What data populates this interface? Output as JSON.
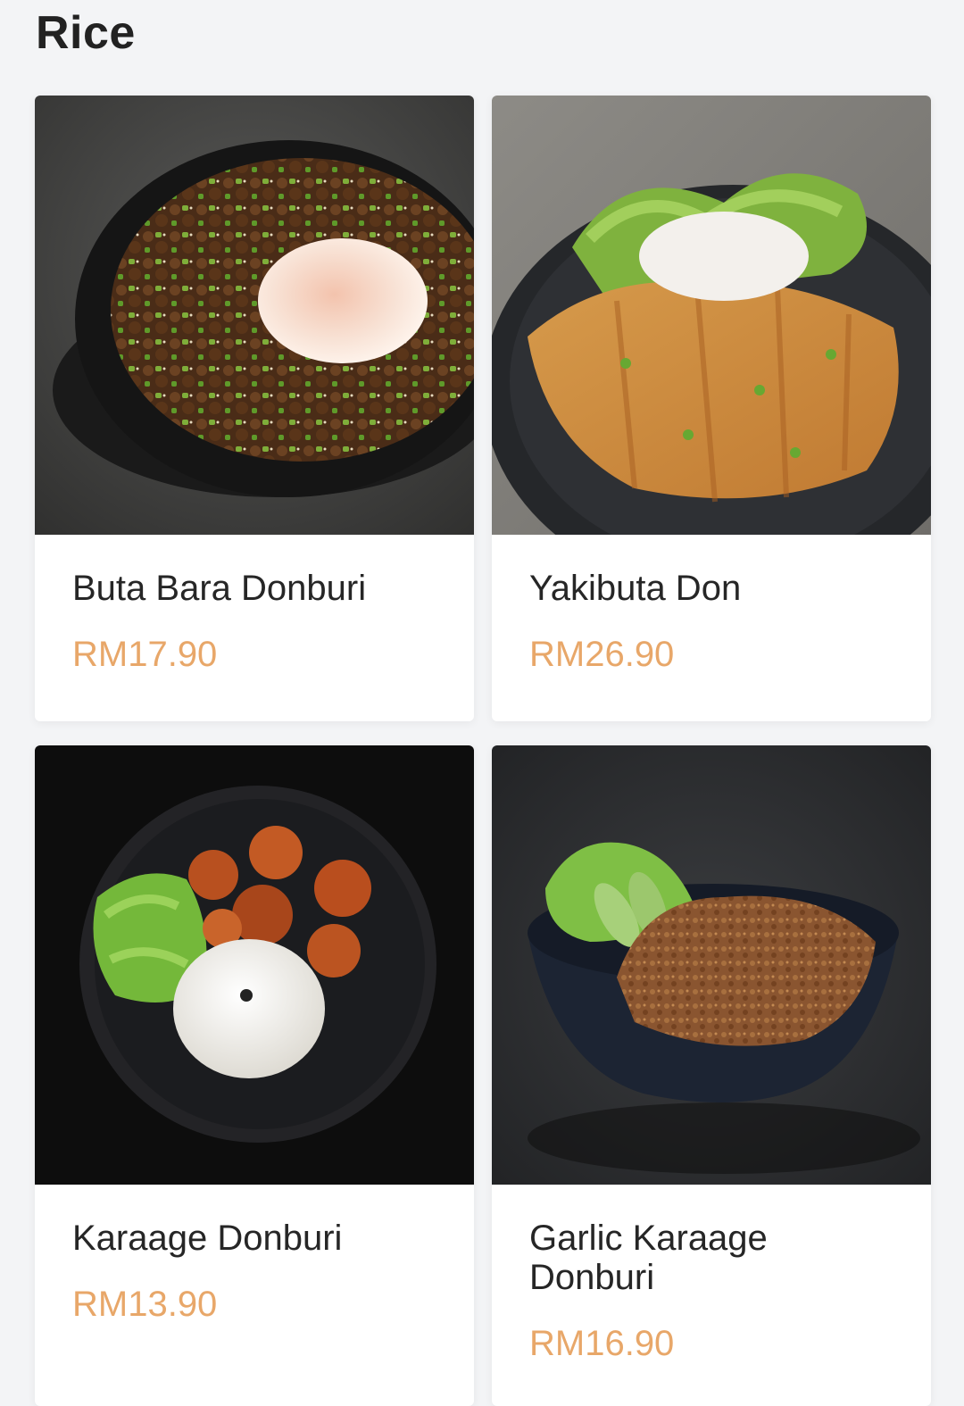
{
  "section": {
    "title": "Rice"
  },
  "colors": {
    "price": "#e8a769",
    "background": "#f3f4f6",
    "card": "#ffffff"
  },
  "items": [
    {
      "name": "Buta Bara Donburi",
      "price": "RM17.90",
      "image": "pork-donburi-egg-photo"
    },
    {
      "name": "Yakibuta Don",
      "price": "RM26.90",
      "image": "yakibuta-don-photo"
    },
    {
      "name": "Karaage Donburi",
      "price": "RM13.90",
      "image": "karaage-rice-photo"
    },
    {
      "name": "Garlic Karaage Donburi",
      "price": "RM16.90",
      "image": "garlic-karaage-bowl-photo"
    }
  ]
}
